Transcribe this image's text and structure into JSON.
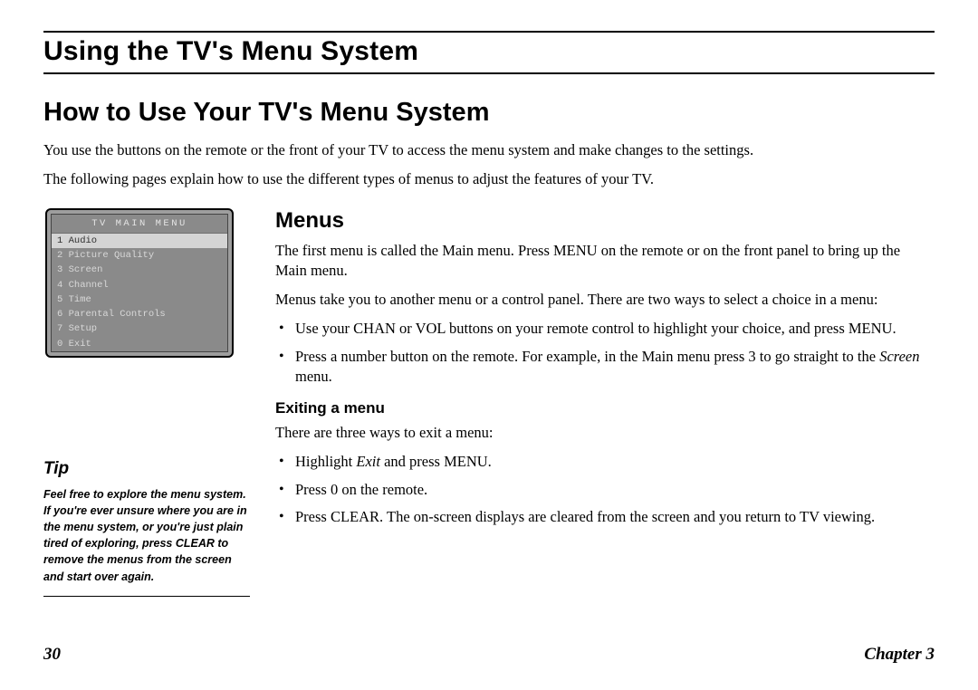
{
  "header": {
    "title": "Using the TV's Menu System"
  },
  "main": {
    "heading": "How to Use Your TV's Menu System",
    "intro1": "You use the buttons on the remote or the front of your TV to access the menu system and make changes to the settings.",
    "intro2": "The following pages explain how to use the different types of menus to adjust the features of your TV."
  },
  "tv_menu": {
    "title": "TV MAIN MENU",
    "items": [
      "1 Audio",
      "2 Picture Quality",
      "3 Screen",
      "4 Channel",
      "5 Time",
      "6 Parental Controls",
      "7 Setup",
      "0 Exit"
    ]
  },
  "menus": {
    "heading": "Menus",
    "p1": "The first menu is called the Main menu. Press MENU on the remote or on the front panel to bring up the Main menu.",
    "p2": "Menus take you to another menu or a control panel. There are two ways to select a choice in a menu:",
    "bullets": [
      "Use your CHAN or VOL buttons on your remote control to highlight your choice, and press MENU.",
      "Press a number button on the remote. For example, in the Main menu press 3 to go straight to the Screen menu."
    ]
  },
  "exiting": {
    "heading": "Exiting a menu",
    "p1": "There are three ways to exit a menu:",
    "bullets": [
      "Highlight Exit and press MENU.",
      "Press 0 on the remote.",
      "Press CLEAR. The on-screen displays are cleared from the screen and you return to TV viewing."
    ]
  },
  "tip": {
    "title": "Tip",
    "body": "Feel free to explore the menu system. If you're ever unsure where you are in the menu system, or you're just plain tired of exploring, press CLEAR to remove the menus from the screen and start over again."
  },
  "footer": {
    "page": "30",
    "chapter": "Chapter 3"
  }
}
